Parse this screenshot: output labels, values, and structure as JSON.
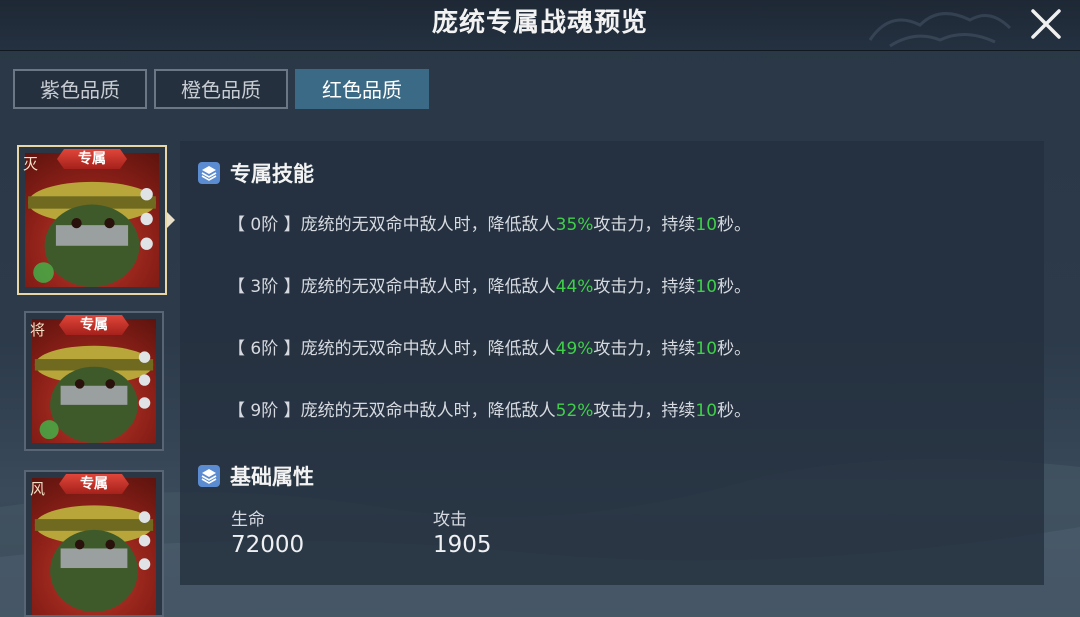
{
  "window": {
    "title": "庞统专属战魂预览"
  },
  "tabs": [
    {
      "label": "紫色品质",
      "active": false
    },
    {
      "label": "橙色品质",
      "active": false
    },
    {
      "label": "红色品质",
      "active": true
    }
  ],
  "heroes": [
    {
      "badge": "专属",
      "grade": "灭",
      "selected": true
    },
    {
      "badge": "专属",
      "grade": "将",
      "selected": false
    },
    {
      "badge": "专属",
      "grade": "风",
      "selected": false
    }
  ],
  "skills_section": {
    "title": "专属技能",
    "levels": [
      {
        "stage": "【 0阶 】",
        "prefix": "庞统的无双命中敌人时，降低敌人",
        "value": "35%",
        "mid": "攻击力，持续",
        "duration": "10",
        "suffix": "秒。"
      },
      {
        "stage": "【 3阶 】",
        "prefix": "庞统的无双命中敌人时，降低敌人",
        "value": "44%",
        "mid": "攻击力，持续",
        "duration": "10",
        "suffix": "秒。"
      },
      {
        "stage": "【 6阶 】",
        "prefix": "庞统的无双命中敌人时，降低敌人",
        "value": "49%",
        "mid": "攻击力，持续",
        "duration": "10",
        "suffix": "秒。"
      },
      {
        "stage": "【 9阶 】",
        "prefix": "庞统的无双命中敌人时，降低敌人",
        "value": "52%",
        "mid": "攻击力，持续",
        "duration": "10",
        "suffix": "秒。"
      }
    ]
  },
  "attributes_section": {
    "title": "基础属性",
    "stats": [
      {
        "label": "生命",
        "value": "72000"
      },
      {
        "label": "攻击",
        "value": "1905"
      }
    ]
  },
  "colors": {
    "accent": "#3a6a85",
    "highlight": "#3fcf4a",
    "badge": "#c8322a"
  },
  "icons": {
    "close": "close-icon",
    "section": "layers-icon"
  }
}
